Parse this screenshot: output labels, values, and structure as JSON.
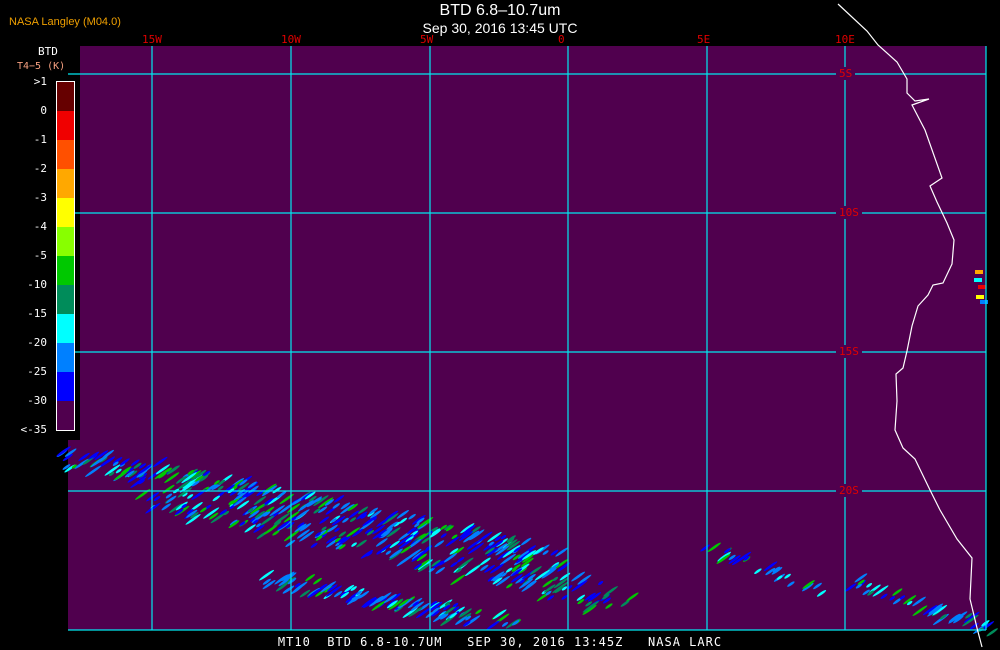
{
  "header": {
    "title": "BTD 6.8–10.7um",
    "subtitle": "Sep 30, 2016 13:45 UTC",
    "brand": "NASA Langley (M04.0)"
  },
  "legend": {
    "title": "BTD",
    "units": "T4−5 (K)",
    "ticks": [
      ">1",
      "0",
      "-1",
      "-2",
      "-3",
      "-4",
      "-5",
      "-10",
      "-15",
      "-20",
      "-25",
      "-30",
      "<-35"
    ],
    "colors": [
      "#660000",
      "#f00000",
      "#ff5000",
      "#ffa800",
      "#ffff00",
      "#88ff00",
      "#00c800",
      "#008c5a",
      "#00ffff",
      "#0080ff",
      "#0000ff",
      "#50004e"
    ]
  },
  "grid": {
    "lon_labels": [
      "15W",
      "10W",
      "5W",
      "0",
      "5E",
      "10E"
    ],
    "lat_labels": [
      "5S",
      "10S",
      "15S",
      "20S"
    ],
    "line_color": "#00e8f0",
    "label_color": "#e00000"
  },
  "colors": {
    "background": "#50004e"
  },
  "footer": "MT10  BTD 6.8-10.7UM   SEP 30, 2016 13:45Z   NASA LARC"
}
